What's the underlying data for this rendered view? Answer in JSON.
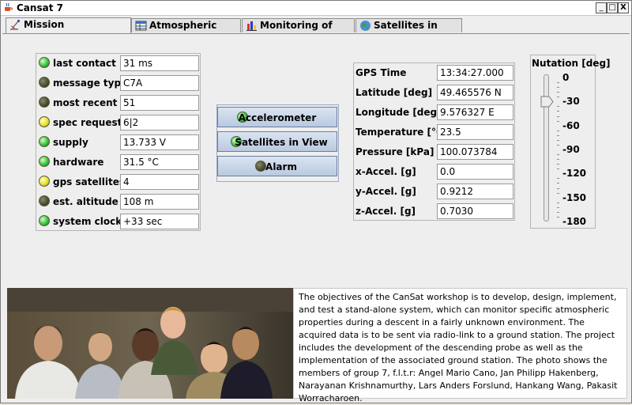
{
  "window": {
    "title": "Cansat 7",
    "controls": [
      "_",
      "□",
      "X"
    ]
  },
  "tabs": [
    {
      "label": "Mission surveillance",
      "active": true,
      "icon": "satellite-dish-icon"
    },
    {
      "label": "Atmospheric data",
      "active": false,
      "icon": "table-icon"
    },
    {
      "label": "Monitoring of data",
      "active": false,
      "icon": "bar-chart-icon"
    },
    {
      "label": "Satellites in view",
      "active": false,
      "icon": "globe-icon"
    }
  ],
  "status": [
    {
      "label": "last contact",
      "value": "31 ms",
      "led": "green"
    },
    {
      "label": "message type",
      "value": "C7A",
      "led": "dark"
    },
    {
      "label": "most recent",
      "value": "51",
      "led": "dark"
    },
    {
      "label": "spec request",
      "value": "6|2",
      "led": "yellow"
    },
    {
      "label": "supply",
      "value": "13.733 V",
      "led": "green"
    },
    {
      "label": "hardware",
      "value": "31.5 °C",
      "led": "green"
    },
    {
      "label": "gps satellites",
      "value": "4",
      "led": "yellow"
    },
    {
      "label": "est. altitude",
      "value": "108 m",
      "led": "dark"
    },
    {
      "label": "system clock",
      "value": "+33 sec",
      "led": "green"
    }
  ],
  "buttons": [
    {
      "label": "Accelerometer",
      "led": "green"
    },
    {
      "label": "Satellites in View",
      "led": "green"
    },
    {
      "label": "Alarm",
      "led": "dark"
    }
  ],
  "readings": [
    {
      "label": "GPS Time",
      "value": "13:34:27.000"
    },
    {
      "label": "Latitude [deg]",
      "value": "49.465576 N"
    },
    {
      "label": "Longitude [deg]",
      "value": "9.576327 E"
    },
    {
      "label": "Temperature [°C]",
      "value": "23.5"
    },
    {
      "label": "Pressure [kPa]",
      "value": "100.073784"
    },
    {
      "label": "x-Accel. [g]",
      "value": "0.0"
    },
    {
      "label": "y-Accel. [g]",
      "value": "0.9212"
    },
    {
      "label": "z-Accel. [g]",
      "value": "0.7030"
    }
  ],
  "nutation": {
    "title": "Nutation [deg]",
    "ticks": [
      "0",
      "-30",
      "-60",
      "-90",
      "-120",
      "-150",
      "-180"
    ],
    "value": -30
  },
  "description": "The objectives of the CanSat workshop is to develop, design, implement, and test a stand-alone system, which can monitor specific atmospheric properties during a descent in a fairly unknown environment. The acquired data is to be sent via radio-link to a ground station. The project includes the development of the descending probe as well as the implementation of the associated ground station. The photo shows the members of group 7, f.l.t.r: Angel Mario Cano, Jan Philipp Hakenberg, Narayanan Krishnamurthy, Lars Anders Forslund, Hankang Wang, Pakasit Worracharoen.",
  "colors": {
    "led_green": "#38c23a",
    "led_yellow": "#e6e230",
    "led_dark": "#4e4e32",
    "button_bg": "#c6d3e8"
  }
}
